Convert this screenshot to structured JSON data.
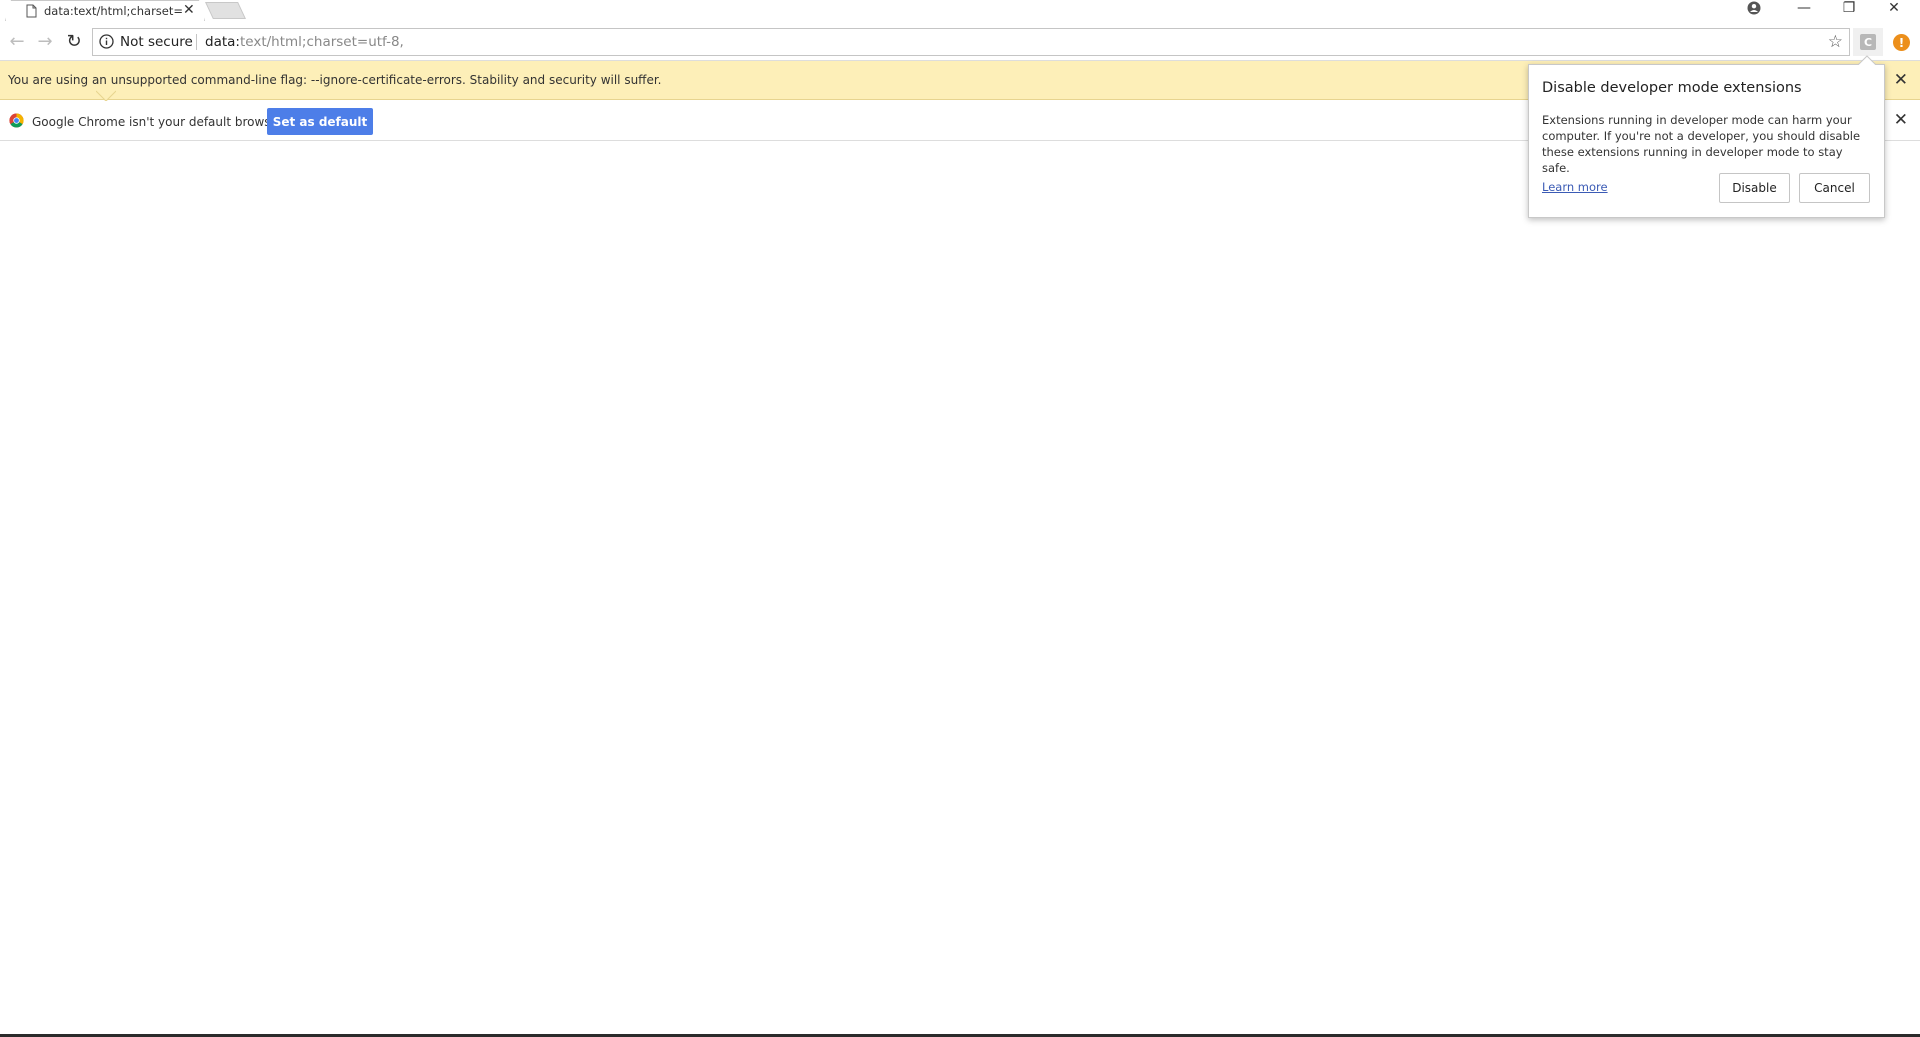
{
  "tab": {
    "title": "data:text/html;charset=u",
    "close_glyph": "✕"
  },
  "window_controls": {
    "profile_icon": "profile-icon",
    "minimize_glyph": "—",
    "restore_glyph": "❐",
    "close_glyph": "✕"
  },
  "toolbar": {
    "back_glyph": "←",
    "forward_glyph": "→",
    "reload_glyph": "↻",
    "security_label": "Not secure",
    "url_main": "data:",
    "url_dim": "text/html;charset=utf-8,",
    "bookmark_glyph": "☆",
    "extension_letter": "C",
    "menu_glyph": "!"
  },
  "warning_infobar": {
    "message": "You are using an unsupported command-line flag: --ignore-certificate-errors. Stability and security will suffer.",
    "close_glyph": "✕",
    "color": "#fdefb8"
  },
  "default_browser_infobar": {
    "message": "Google Chrome isn't your default browser.",
    "button_label": "Set as default",
    "close_glyph": "✕",
    "button_color": "#4d7ee8"
  },
  "dev_mode_bubble": {
    "title": "Disable developer mode extensions",
    "body": "Extensions running in developer mode can harm your computer. If you're not a developer, you should disable these extensions running in developer mode to stay safe.",
    "learn_more": "Learn more",
    "disable_label": "Disable",
    "cancel_label": "Cancel"
  }
}
